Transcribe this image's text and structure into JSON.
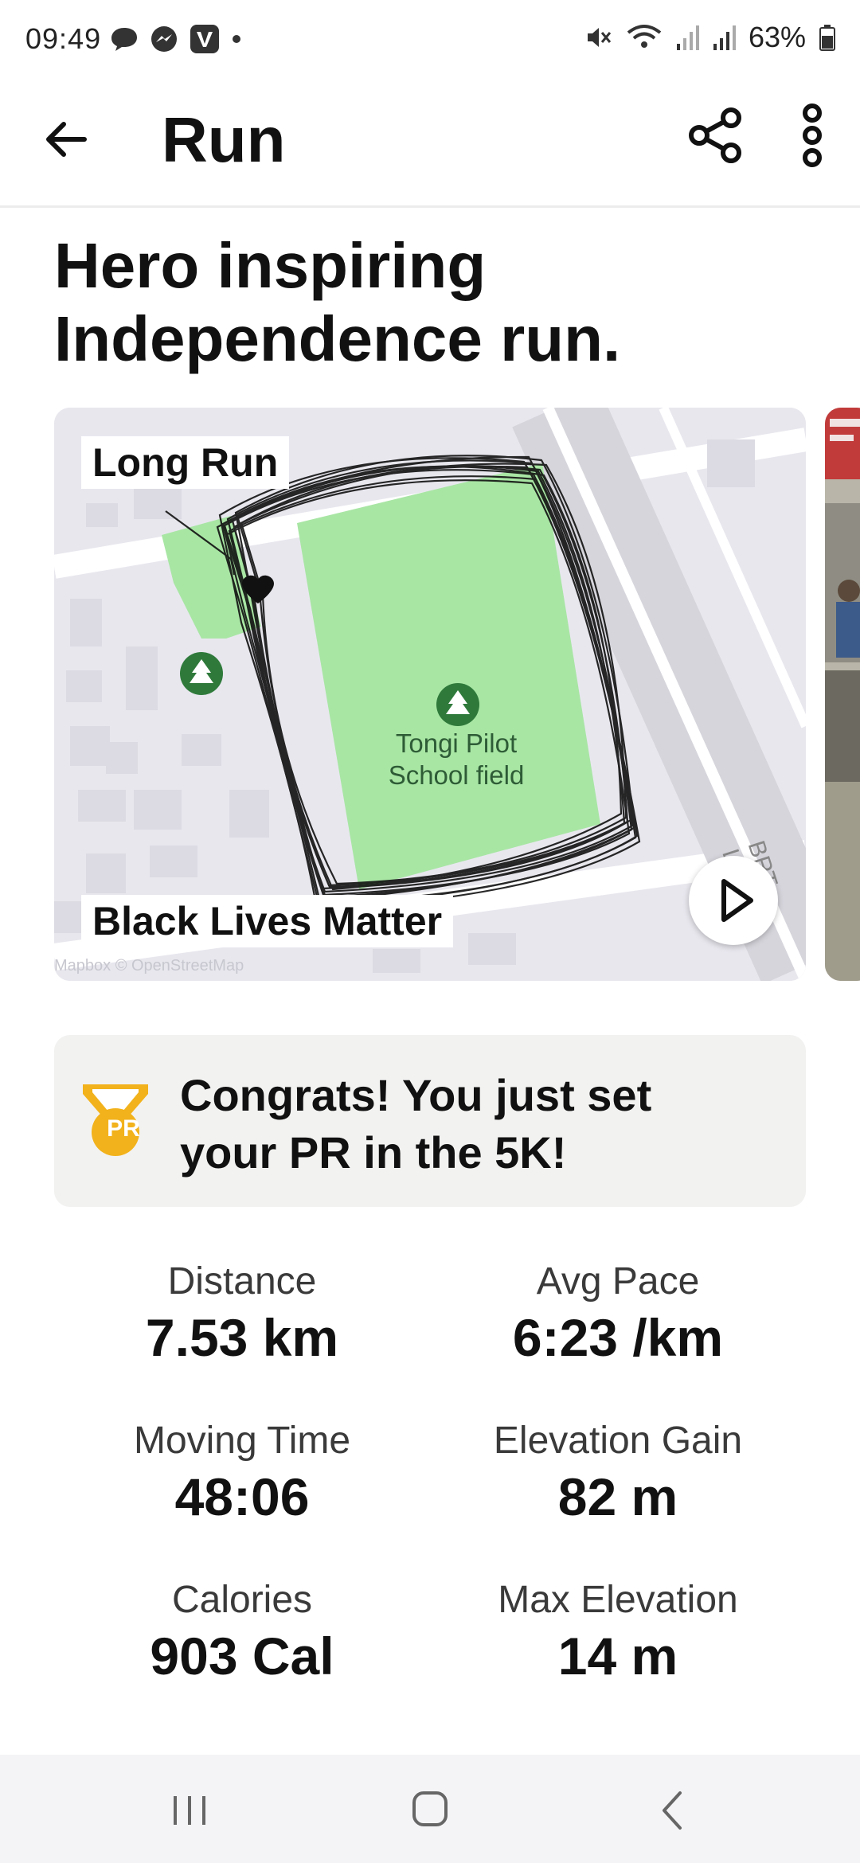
{
  "status_bar": {
    "time": "09:49",
    "battery": "63%"
  },
  "app_bar": {
    "title": "Run"
  },
  "activity": {
    "title": "Hero inspiring\nIndependence run.",
    "map": {
      "tag_top": "Long Run",
      "tag_bottom": "Black Lives Matter",
      "field_label": "Tongi Pilot\nSchool field",
      "attribution": "Mapbox © OpenStreetMap",
      "road_label": "BRT L",
      "route_color": "#111111",
      "field_color": "#a8e6a4"
    }
  },
  "pr_banner": {
    "text": "Congrats! You just set\nyour PR in the 5K!",
    "badge_text": "PR",
    "badge_color": "#f2b21b"
  },
  "stats": [
    {
      "label": "Distance",
      "value": "7.53 km"
    },
    {
      "label": "Avg Pace",
      "value": "6:23 /km"
    },
    {
      "label": "Moving Time",
      "value": "48:06"
    },
    {
      "label": "Elevation Gain",
      "value": "82 m"
    },
    {
      "label": "Calories",
      "value": "903 Cal"
    },
    {
      "label": "Max Elevation",
      "value": "14 m"
    }
  ]
}
